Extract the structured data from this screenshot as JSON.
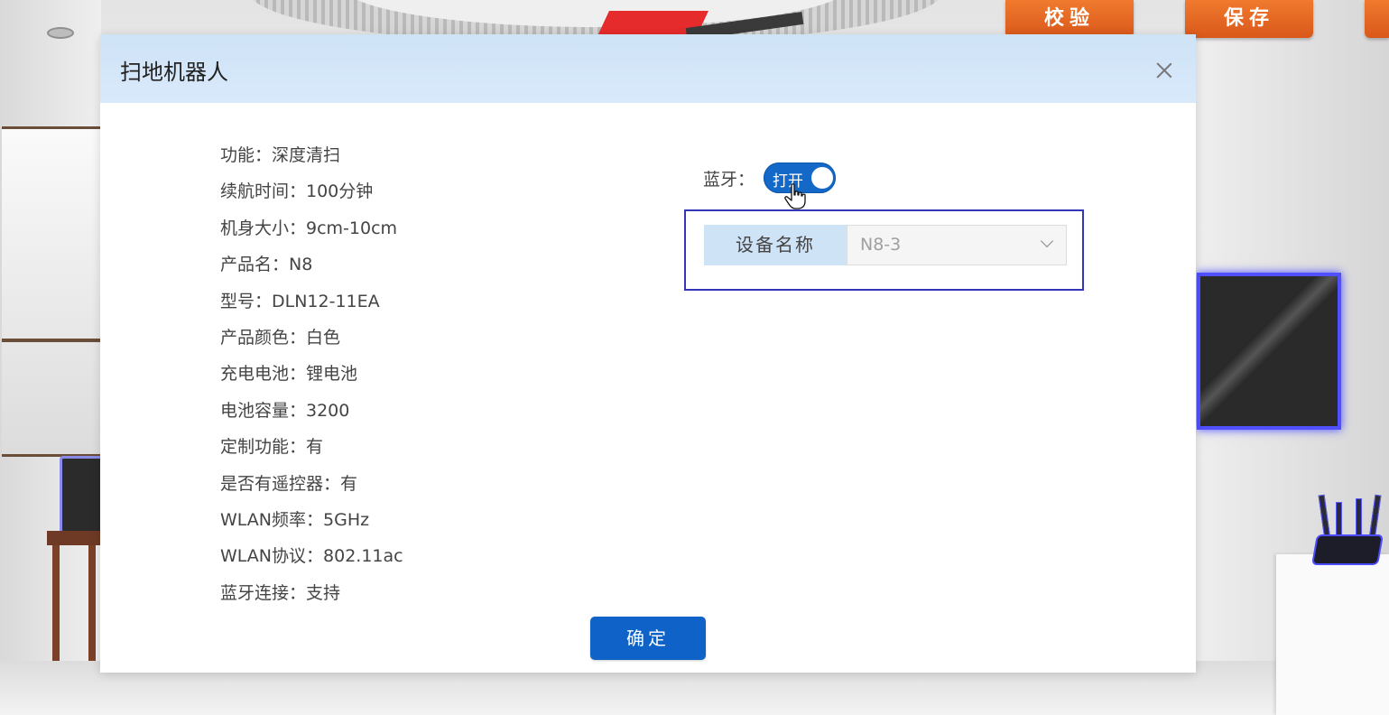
{
  "toolbar": {
    "verify_label": "校验",
    "save_label": "保存"
  },
  "dialog": {
    "title": "扫地机器人",
    "specs": [
      "功能：深度清扫",
      "续航时间：100分钟",
      "机身大小：9cm-10cm",
      "产品名：N8",
      "型号：DLN12-11EA",
      "产品颜色：白色",
      "充电电池：锂电池",
      "电池容量：3200",
      "定制功能：有",
      "是否有遥控器：有",
      "WLAN频率：5GHz",
      "WLAN协议：802.11ac",
      "蓝牙连接：支持"
    ],
    "bluetooth": {
      "label": "蓝牙：",
      "toggle_text": "打开",
      "state": "on"
    },
    "device": {
      "label": "设备名称",
      "selected": "N8-3"
    },
    "confirm_label": "确定"
  },
  "colors": {
    "header_bg": "#cfe3f7",
    "primary": "#0e62c8",
    "toolbar_orange": "#e96c25",
    "highlight_border": "#3535b8"
  }
}
